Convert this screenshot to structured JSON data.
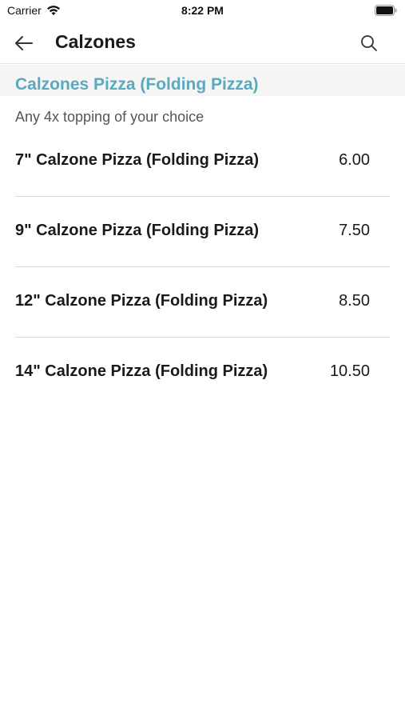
{
  "status_bar": {
    "carrier": "Carrier",
    "time": "8:22 PM"
  },
  "nav": {
    "title": "Calzones",
    "back_icon": "arrow-left-icon",
    "search_icon": "search-icon"
  },
  "section": {
    "title": "Calzones Pizza (Folding Pizza)",
    "description": "Any 4x topping of your choice",
    "accent_color": "#5aa9bd"
  },
  "items": [
    {
      "name": "7\" Calzone Pizza (Folding Pizza)",
      "price": "6.00"
    },
    {
      "name": "9\" Calzone Pizza (Folding Pizza)",
      "price": "7.50"
    },
    {
      "name": "12\" Calzone Pizza (Folding Pizza)",
      "price": "8.50"
    },
    {
      "name": "14\" Calzone Pizza (Folding Pizza)",
      "price": "10.50"
    }
  ]
}
